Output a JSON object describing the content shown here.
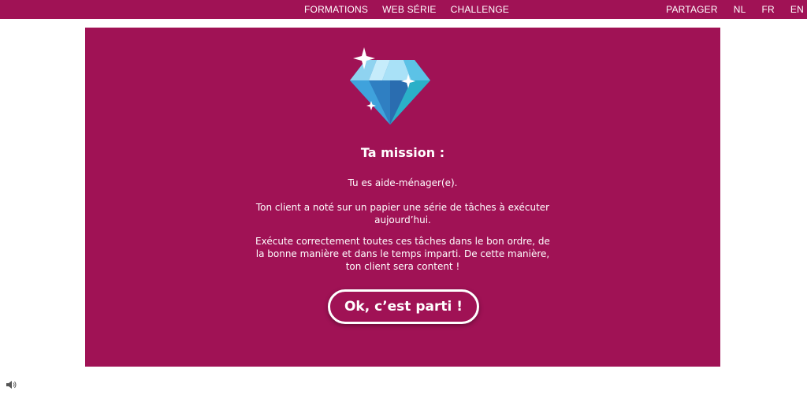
{
  "header": {
    "nav_center": [
      "FORMATIONS",
      "WEB SÉRIE",
      "CHALLENGE"
    ],
    "nav_right": [
      "PARTAGER",
      "NL",
      "FR",
      "EN"
    ]
  },
  "mission": {
    "icon": "diamond-icon",
    "title": "Ta mission :",
    "paragraphs": [
      "Tu es aide-ménager(e).",
      "Ton client a noté sur un papier une série de tâches à exécuter aujourd’hui.",
      "Exécute correctement toutes ces tâches dans le bon ordre, de la bonne manière et dans le temps imparti. De cette manière, ton client sera content !"
    ],
    "cta_label": "Ok, c’est parti !"
  },
  "footer": {
    "icon": "speaker-icon"
  },
  "colors": {
    "brand": "#a01255",
    "text": "#ffffff"
  }
}
